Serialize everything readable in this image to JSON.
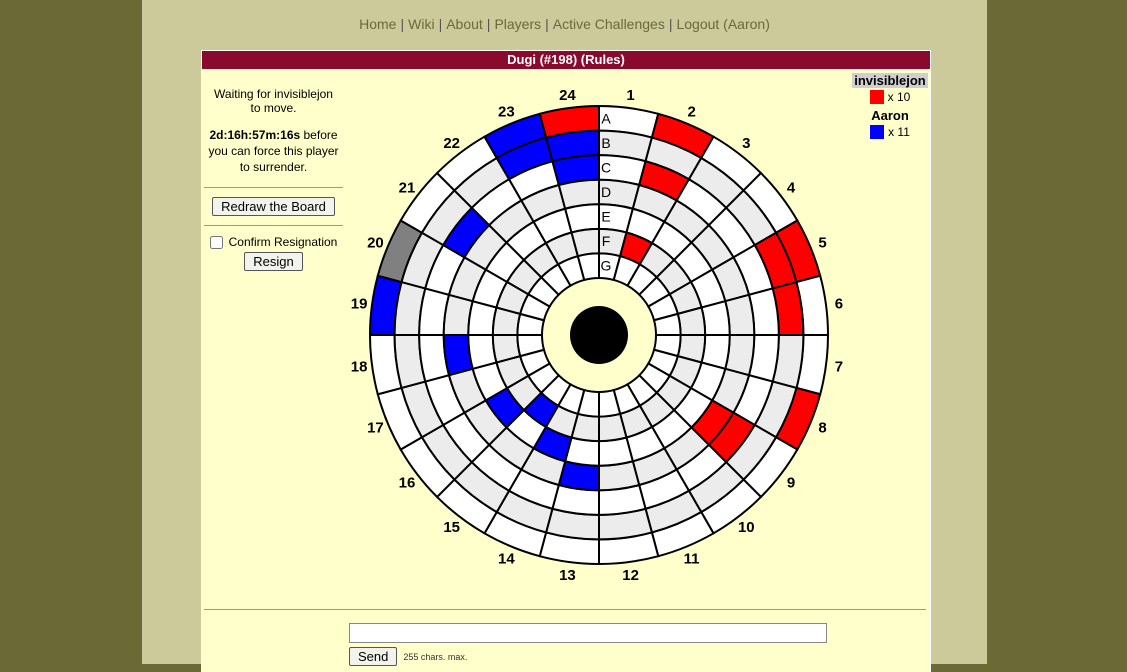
{
  "nav": {
    "items": [
      {
        "label": "Home"
      },
      {
        "label": "Wiki"
      },
      {
        "label": "About"
      },
      {
        "label": "Players"
      },
      {
        "label": "Active Challenges"
      },
      {
        "label": "Logout (Aaron)"
      }
    ]
  },
  "game": {
    "title": "Dugi (#198) (",
    "rules_link": "Rules",
    "title_close": ")"
  },
  "status": {
    "waiting": "Waiting for invisiblejon to move.",
    "timer": "2d:16h:57m:16s",
    "timer_suffix": " before you can force this player to surrender."
  },
  "controls": {
    "redraw_label": "Redraw the Board",
    "confirm_label": "Confirm Resignation",
    "resign_label": "Resign"
  },
  "players": [
    {
      "name": "invisiblejon",
      "count": "x 10",
      "color": "#ff0000",
      "highlight": true
    },
    {
      "name": "Aaron",
      "count": "x 11",
      "color": "#0000ff",
      "highlight": false
    }
  ],
  "board": {
    "sectors": 24,
    "rings": [
      "A",
      "B",
      "C",
      "D",
      "E",
      "F",
      "G"
    ],
    "colors": {
      "red": "#ff0000",
      "blue": "#0000ff",
      "gray": "#808080",
      "light": "#ececec",
      "white": "#ffffff"
    },
    "pieces": [
      {
        "sector": 24,
        "ring": 0,
        "color": "red"
      },
      {
        "sector": 23,
        "ring": 0,
        "color": "blue"
      },
      {
        "sector": 23,
        "ring": 1,
        "color": "blue"
      },
      {
        "sector": 24,
        "ring": 1,
        "color": "blue"
      },
      {
        "sector": 24,
        "ring": 2,
        "color": "blue"
      },
      {
        "sector": 2,
        "ring": 0,
        "color": "red"
      },
      {
        "sector": 2,
        "ring": 2,
        "color": "red"
      },
      {
        "sector": 5,
        "ring": 0,
        "color": "red"
      },
      {
        "sector": 5,
        "ring": 1,
        "color": "red"
      },
      {
        "sector": 6,
        "ring": 1,
        "color": "red"
      },
      {
        "sector": 2,
        "ring": 5,
        "color": "red"
      },
      {
        "sector": 8,
        "ring": 0,
        "color": "red"
      },
      {
        "sector": 9,
        "ring": 2,
        "color": "red"
      },
      {
        "sector": 9,
        "ring": 3,
        "color": "red"
      },
      {
        "sector": 21,
        "ring": 2,
        "color": "blue"
      },
      {
        "sector": 20,
        "ring": 0,
        "color": "gray"
      },
      {
        "sector": 19,
        "ring": 0,
        "color": "blue"
      },
      {
        "sector": 18,
        "ring": 3,
        "color": "blue"
      },
      {
        "sector": 16,
        "ring": 4,
        "color": "blue"
      },
      {
        "sector": 15,
        "ring": 5,
        "color": "blue"
      },
      {
        "sector": 14,
        "ring": 4,
        "color": "blue"
      },
      {
        "sector": 13,
        "ring": 3,
        "color": "blue"
      }
    ]
  },
  "chat": {
    "input_value": "",
    "send_label": "Send",
    "max_note": "255 chars. max."
  }
}
